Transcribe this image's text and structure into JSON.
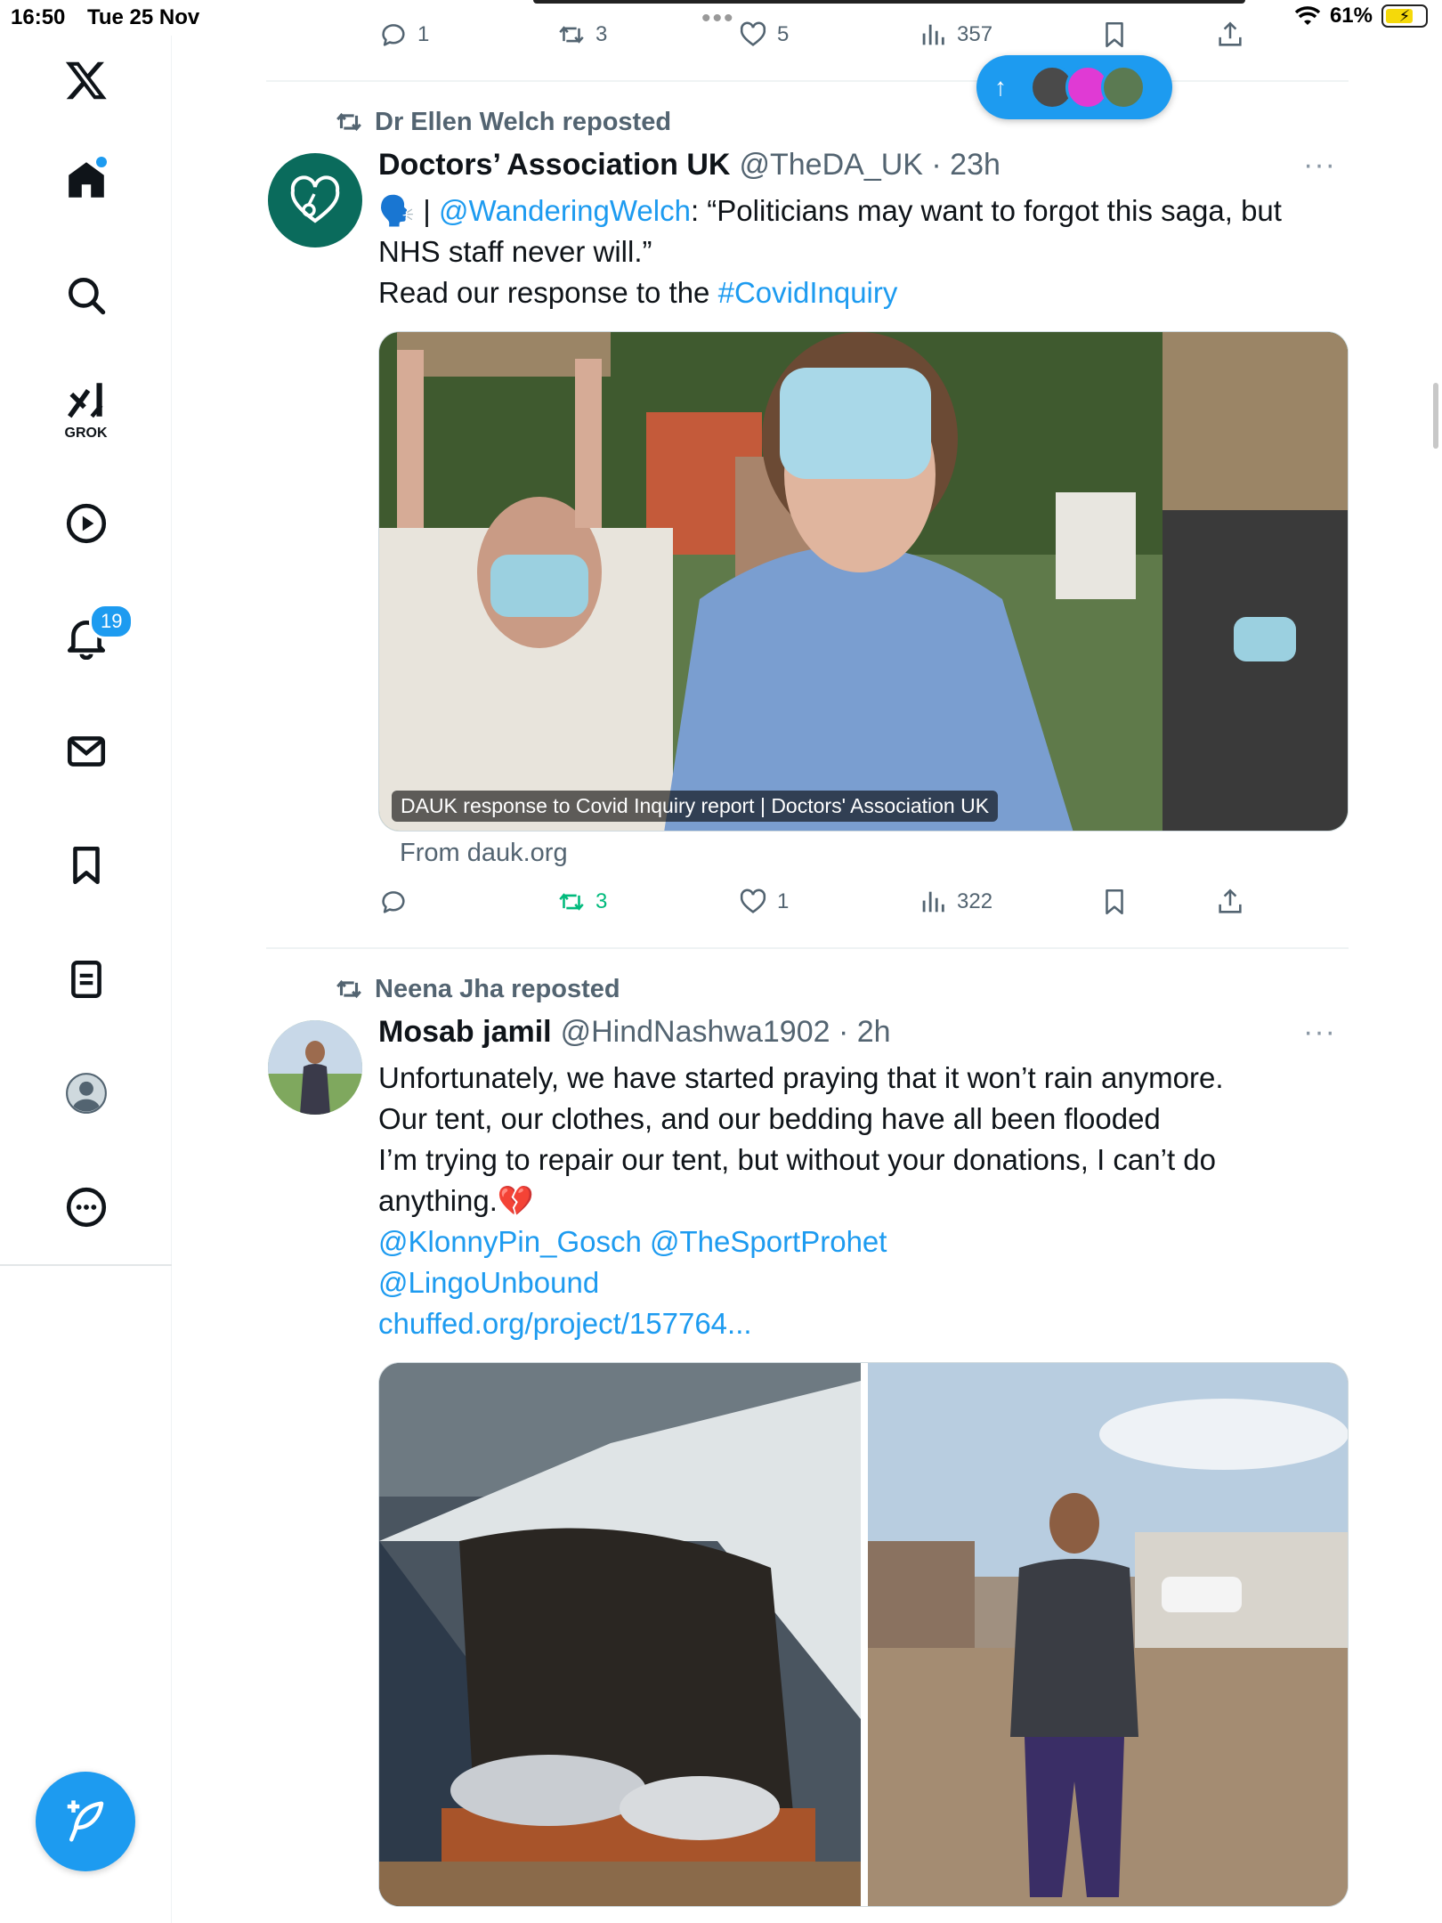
{
  "status_bar": {
    "time": "16:50",
    "date": "Tue 25 Nov",
    "battery": "61%"
  },
  "sidebar": {
    "grok_label": "GROK",
    "notifications_badge": "19"
  },
  "new_posts_pill": {
    "arrow": "↑"
  },
  "top_tweet_actions": {
    "replies": "1",
    "reposts": "3",
    "likes": "5",
    "views": "357"
  },
  "tweet1": {
    "reposted_by": "Dr Ellen Welch reposted",
    "name": "Doctors’ Association UK",
    "handle": "@TheDA_UK · 23h",
    "more": "···",
    "text_emoji": "🗣️",
    "text_sep": " | ",
    "text_mention": "@WanderingWelch",
    "text_quote": ": “Politicians may want to forgot this saga, but NHS staff never will.”",
    "text_line2": "Read our response to the ",
    "text_hashtag": "#CovidInquiry",
    "card_caption": "DAUK response to Covid Inquiry report | Doctors' Association UK",
    "card_from": "From dauk.org",
    "actions": {
      "replies": "",
      "reposts": "3",
      "likes": "1",
      "views": "322"
    }
  },
  "tweet2": {
    "reposted_by": "Neena Jha reposted",
    "name": "Mosab jamil",
    "handle": "@HindNashwa1902 · 2h",
    "more": "···",
    "line1": "Unfortunately, we have started praying that it won’t rain anymore.",
    "line2": "Our tent, our clothes, and our bedding have all been flooded",
    "line3": "I’m trying to repair our tent, but without your donations, I can’t do",
    "line4": "anything.💔",
    "mentions1": "@KlonnyPin_Gosch @TheSportProhet",
    "mentions2": "@LingoUnbound",
    "link": "chuffed.org/project/157764..."
  },
  "colors": {
    "accent": "#1d9bf0",
    "repost_green": "#00ba7c",
    "secondary_text": "#536471",
    "dauk_avatar": "#0a6b5c"
  },
  "icons": [
    "x-logo-icon",
    "home-icon",
    "search-icon",
    "grok-icon",
    "play-icon",
    "bell-icon",
    "mail-icon",
    "bookmark-icon",
    "list-icon",
    "profile-icon",
    "more-circle-icon",
    "compose-icon",
    "reply-icon",
    "repost-icon",
    "like-icon",
    "views-icon",
    "share-icon",
    "wifi-icon",
    "battery-icon"
  ]
}
